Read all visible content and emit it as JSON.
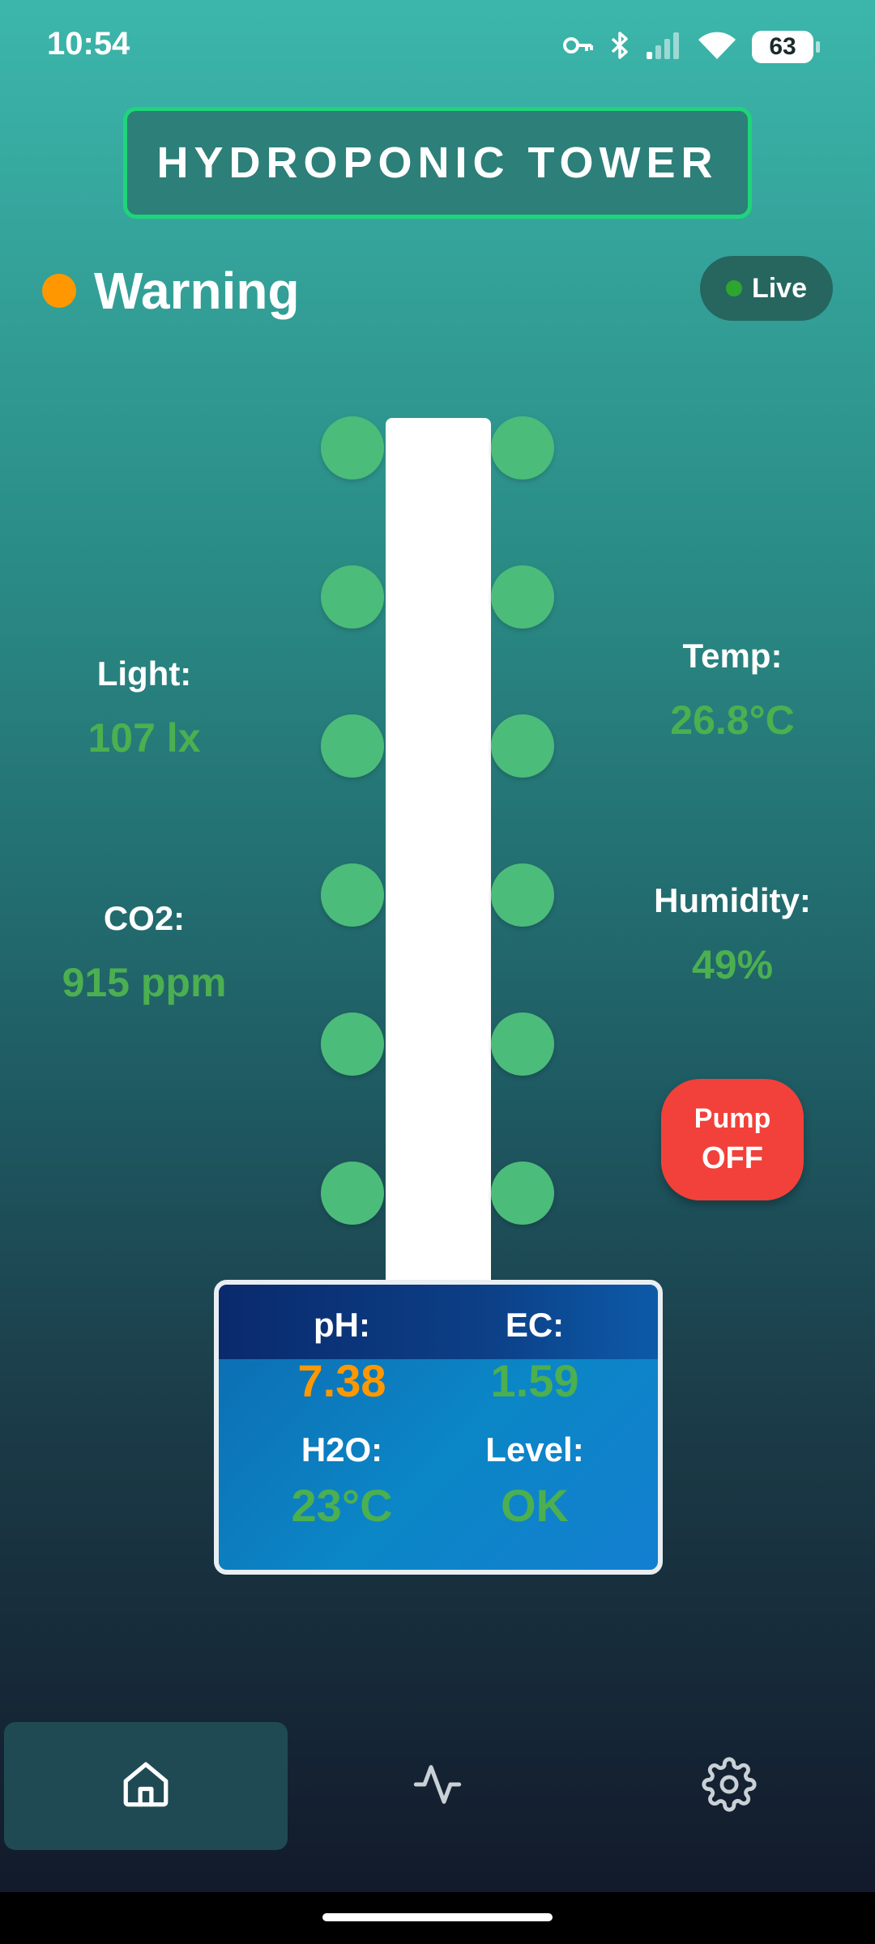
{
  "status_bar": {
    "time": "10:54",
    "battery": "63",
    "icons": [
      "vpn-key-icon",
      "bluetooth-icon",
      "signal-icon",
      "wifi-icon",
      "battery-icon"
    ]
  },
  "header": {
    "title": "HYDROPONIC TOWER"
  },
  "system_status": {
    "label": "Warning",
    "color": "#ff9800"
  },
  "live_indicator": {
    "label": "Live",
    "color": "#2ea52e"
  },
  "metrics": {
    "light": {
      "label": "Light:",
      "value": "107 lx"
    },
    "co2": {
      "label": "CO2:",
      "value": "915 ppm"
    },
    "temp": {
      "label": "Temp:",
      "value": "26.8°C"
    },
    "humidity": {
      "label": "Humidity:",
      "value": "49%"
    }
  },
  "pump": {
    "label": "Pump",
    "state": "OFF",
    "color": "#f1413a"
  },
  "water_panel": {
    "ph": {
      "label": "pH:",
      "value": "7.38",
      "color": "#ff9800"
    },
    "ec": {
      "label": "EC:",
      "value": "1.59",
      "color": "#4caf50"
    },
    "h2o": {
      "label": "H2O:",
      "value": "23°C",
      "color": "#4caf50"
    },
    "level": {
      "label": "Level:",
      "value": "OK",
      "color": "#4caf50"
    }
  },
  "nav": {
    "items": [
      {
        "icon": "home-icon",
        "active": true
      },
      {
        "icon": "activity-icon",
        "active": false
      },
      {
        "icon": "gear-icon",
        "active": false
      }
    ]
  },
  "colors": {
    "accent_green": "#4caf50",
    "title_border": "#1fd57a",
    "pod_green": "#4cbc7a"
  }
}
